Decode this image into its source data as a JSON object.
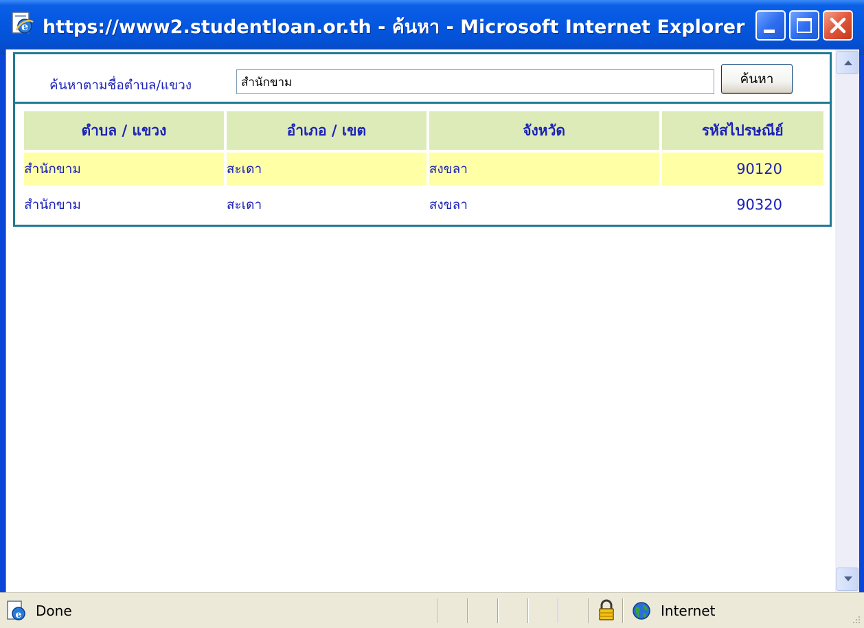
{
  "window": {
    "title": "https://www2.studentloan.or.th - ค้นหา - Microsoft Internet Explorer"
  },
  "search": {
    "label": "ค้นหาตามชื่อตำบล/แขวง",
    "value": "สำนักขาม",
    "button_label": "ค้นหา"
  },
  "table": {
    "headers": [
      "ตำบล / แขวง",
      "อำเภอ / เขต",
      "จังหวัด",
      "รหัสไปรษณีย์"
    ],
    "rows": [
      [
        "สำนักขาม",
        "สะเดา",
        "สงขลา",
        "90120"
      ],
      [
        "สำนักขาม",
        "สะเดา",
        "สงขลา",
        "90320"
      ]
    ]
  },
  "statusbar": {
    "text": "Done",
    "zone": "Internet"
  },
  "icons": {
    "window": "ie-page-icon",
    "minimize": "minimize-icon",
    "maximize": "maximize-icon",
    "close": "close-icon",
    "scroll_up": "arrow-up-icon",
    "scroll_down": "arrow-down-icon",
    "status": "ie-page-icon",
    "lock": "lock-icon",
    "globe": "globe-icon"
  },
  "colors": {
    "title_bar": "#0457e0",
    "header_bg": "#dcebb8",
    "highlight_row": "#ffffa6",
    "text": "#1c22b8",
    "panel_border": "#1f7a94"
  }
}
